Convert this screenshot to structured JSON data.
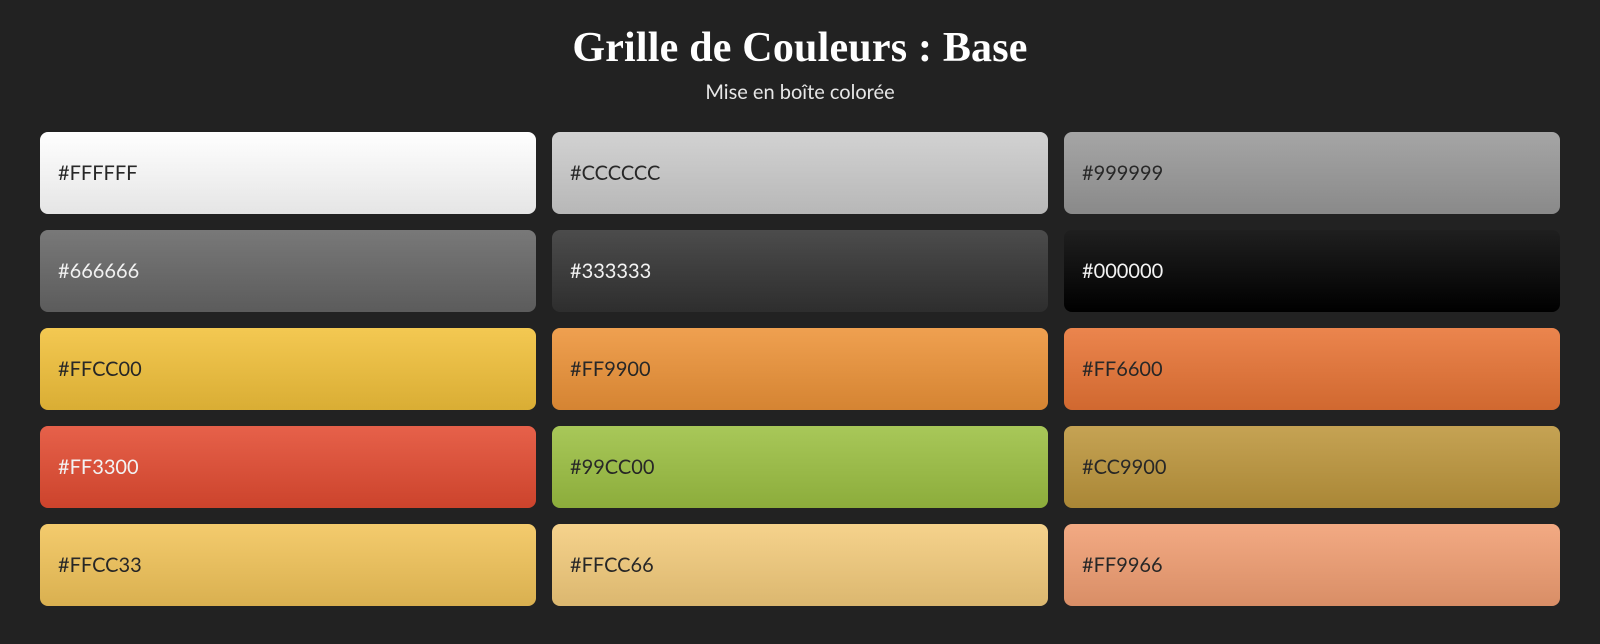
{
  "header": {
    "title": "Grille de Couleurs : Base",
    "subtitle": "Mise en boîte colorée"
  },
  "swatches": [
    {
      "label": "#FFFFFF",
      "bg": "#FFFFFF",
      "fg": "#1a1a1a"
    },
    {
      "label": "#CCCCCC",
      "bg": "#CCCCCC",
      "fg": "#1a1a1a"
    },
    {
      "label": "#999999",
      "bg": "#999999",
      "fg": "#1a1a1a"
    },
    {
      "label": "#666666",
      "bg": "#666666",
      "fg": "#ffffff"
    },
    {
      "label": "#333333",
      "bg": "#333333",
      "fg": "#ffffff"
    },
    {
      "label": "#000000",
      "bg": "#000000",
      "fg": "#ffffff"
    },
    {
      "label": "#FFCC00",
      "bg": "#F2C13A",
      "fg": "#1a1a1a"
    },
    {
      "label": "#FF9900",
      "bg": "#ED9338",
      "fg": "#1a1a1a"
    },
    {
      "label": "#FF6600",
      "bg": "#E87435",
      "fg": "#1a1a1a"
    },
    {
      "label": "#FF3300",
      "bg": "#E34B31",
      "fg": "#ffffff"
    },
    {
      "label": "#99CC00",
      "bg": "#9CC042",
      "fg": "#1a1a1a"
    },
    {
      "label": "#CC9900",
      "bg": "#BD963C",
      "fg": "#1a1a1a"
    },
    {
      "label": "#FFCC33",
      "bg": "#F2C459",
      "fg": "#1a1a1a"
    },
    {
      "label": "#FFCC66",
      "bg": "#F4CC7C",
      "fg": "#1a1a1a"
    },
    {
      "label": "#FF9966",
      "bg": "#F19E72",
      "fg": "#1a1a1a"
    }
  ]
}
